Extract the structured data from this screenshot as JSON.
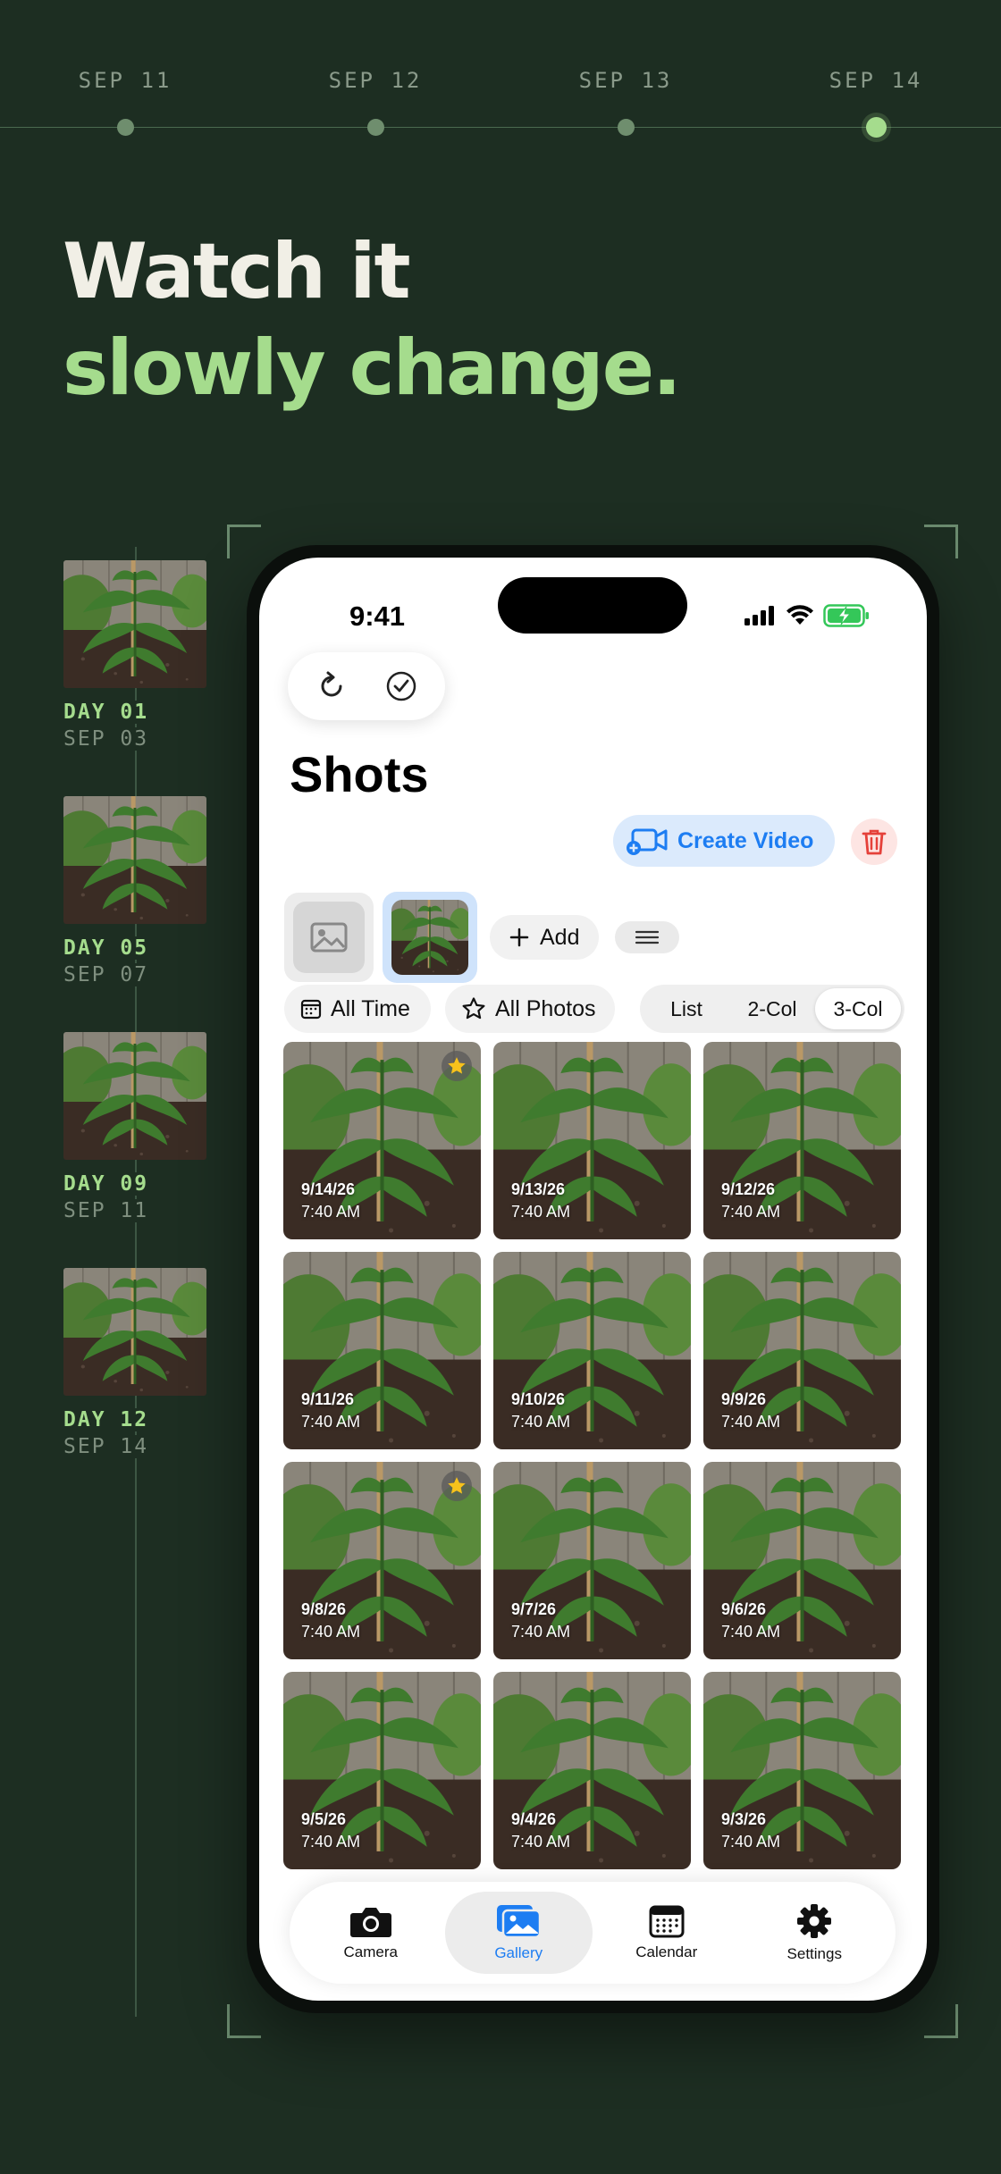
{
  "timeline": {
    "dates": [
      "SEP 11",
      "SEP 12",
      "SEP 13",
      "SEP 14"
    ],
    "active_index": 3
  },
  "headline": {
    "line1": "Watch it",
    "line2": "slowly change."
  },
  "filmstrip": [
    {
      "day": "DAY 01",
      "date": "SEP 03"
    },
    {
      "day": "DAY 05",
      "date": "SEP 07"
    },
    {
      "day": "DAY 09",
      "date": "SEP 11"
    },
    {
      "day": "DAY 12",
      "date": "SEP 14"
    }
  ],
  "phone": {
    "status": {
      "time": "9:41"
    },
    "title": "Shots",
    "create_video_label": "Create Video",
    "add_label": "Add",
    "filters": {
      "time": "All Time",
      "photos": "All Photos",
      "view_modes": [
        "List",
        "2-Col",
        "3-Col"
      ],
      "selected_view": "3-Col"
    },
    "photos": [
      {
        "date": "9/14/26",
        "time": "7:40 AM",
        "favorite": true
      },
      {
        "date": "9/13/26",
        "time": "7:40 AM",
        "favorite": false
      },
      {
        "date": "9/12/26",
        "time": "7:40 AM",
        "favorite": false
      },
      {
        "date": "9/11/26",
        "time": "7:40 AM",
        "favorite": false
      },
      {
        "date": "9/10/26",
        "time": "7:40 AM",
        "favorite": false
      },
      {
        "date": "9/9/26",
        "time": "7:40 AM",
        "favorite": false
      },
      {
        "date": "9/8/26",
        "time": "7:40 AM",
        "favorite": true
      },
      {
        "date": "9/7/26",
        "time": "7:40 AM",
        "favorite": false
      },
      {
        "date": "9/6/26",
        "time": "7:40 AM",
        "favorite": false
      },
      {
        "date": "9/5/26",
        "time": "7:40 AM",
        "favorite": false
      },
      {
        "date": "9/4/26",
        "time": "7:40 AM",
        "favorite": false
      },
      {
        "date": "9/3/26",
        "time": "7:40 AM",
        "favorite": false
      }
    ],
    "tabs": [
      {
        "label": "Camera",
        "icon": "camera-icon"
      },
      {
        "label": "Gallery",
        "icon": "gallery-icon"
      },
      {
        "label": "Calendar",
        "icon": "calendar-icon"
      },
      {
        "label": "Settings",
        "icon": "gear-icon"
      }
    ],
    "selected_tab": "Gallery"
  },
  "colors": {
    "background": "#1d2e22",
    "accent_green": "#a5dc8d",
    "ios_blue": "#1d7df2",
    "destructive_red": "#e5413a",
    "favorite_star": "#f7c21b"
  }
}
